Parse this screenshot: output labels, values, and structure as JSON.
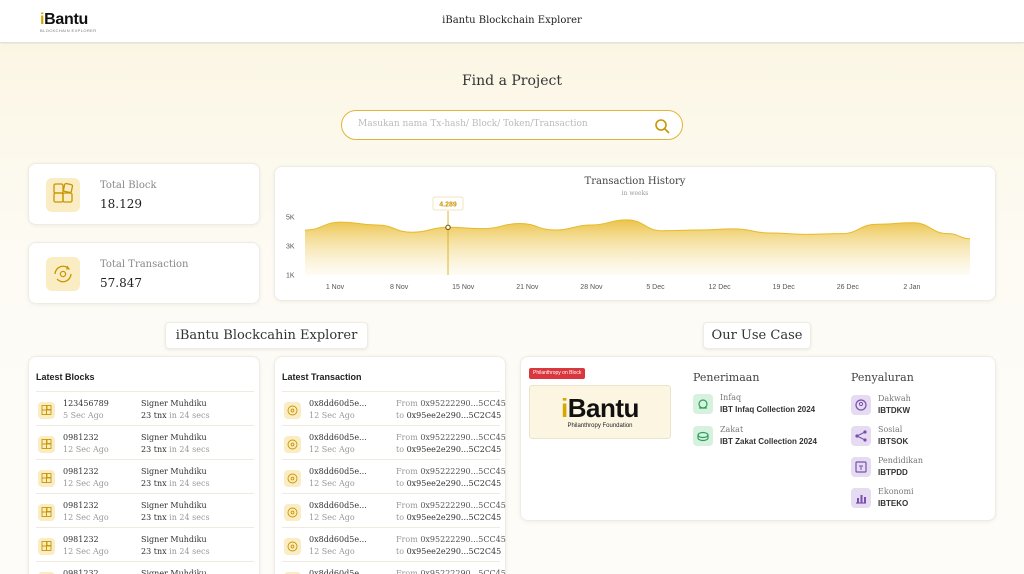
{
  "header": {
    "logo_text": "Bantu",
    "logo_i": "i",
    "logo_sub": "BLOCKCHAIN EXPLORER",
    "title": "iBantu Blockchain Explorer"
  },
  "search": {
    "title": "Find a Project",
    "placeholder": "Masukan nama Tx-hash/ Block/ Token/Transaction",
    "value": ""
  },
  "stats": {
    "block": {
      "label": "Total Block",
      "value": "18.129",
      "icon": "blocks-icon"
    },
    "transaction": {
      "label": "Total Transaction",
      "value": "57.847",
      "icon": "transaction-icon"
    }
  },
  "chart_data": {
    "type": "area",
    "title": "Transaction History",
    "subtitle": "in weeks",
    "x_ticks": [
      "1 Nov",
      "8 Nov",
      "15 Nov",
      "21 Nov",
      "28 Nov",
      "5 Dec",
      "12 Dec",
      "19 Dec",
      "26 Dec",
      "2 Jan"
    ],
    "y_ticks": [
      "1K",
      "3K",
      "5K"
    ],
    "ylim": [
      1000,
      5000
    ],
    "x": [
      0,
      0.5,
      1,
      1.5,
      2,
      2.5,
      3,
      3.5,
      4,
      4.5,
      5,
      5.5,
      6,
      6.5,
      7,
      7.5,
      8,
      8.5,
      9,
      9.3
    ],
    "values": [
      4100,
      4650,
      4450,
      3950,
      4289,
      4200,
      4550,
      4100,
      4450,
      4800,
      4050,
      4100,
      4180,
      3900,
      3800,
      3850,
      4500,
      4600,
      3850,
      3500
    ],
    "tooltip": {
      "x": 2,
      "value": "4.289"
    },
    "color": "#e8b92a",
    "grid": false
  },
  "sections": {
    "explorer_title": "iBantu Blockcahin Explorer",
    "usecase_title": "Our Use Case"
  },
  "latest_blocks": {
    "title": "Latest Blocks",
    "rows": [
      {
        "id": "123456789",
        "age": "5 Sec Ago",
        "signer": "Signer Muhdiku",
        "tnx": "23 tnx",
        "in": "in",
        "secs": "24 secs"
      },
      {
        "id": "0981232",
        "age": "12 Sec Ago",
        "signer": "Signer Muhdiku",
        "tnx": "23 tnx",
        "in": "in",
        "secs": "24 secs"
      },
      {
        "id": "0981232",
        "age": "12 Sec Ago",
        "signer": "Signer Muhdiku",
        "tnx": "23 tnx",
        "in": "in",
        "secs": "24 secs"
      },
      {
        "id": "0981232",
        "age": "12 Sec Ago",
        "signer": "Signer Muhdiku",
        "tnx": "23 tnx",
        "in": "in",
        "secs": "24 secs"
      },
      {
        "id": "0981232",
        "age": "12 Sec Ago",
        "signer": "Signer Muhdiku",
        "tnx": "23 tnx",
        "in": "in",
        "secs": "24 secs"
      },
      {
        "id": "0981232",
        "age": "",
        "signer": "Signer Muhdiku",
        "tnx": "",
        "in": "",
        "secs": ""
      }
    ]
  },
  "latest_transactions": {
    "title": "Latest Transaction",
    "rows": [
      {
        "hash": "0x8dd60d5e...",
        "age": "12 Sec Ago",
        "from_label": "From",
        "from": "0x95222290...5CC45",
        "to_label": "to",
        "to": "0x95ee2e290...5C2C45"
      },
      {
        "hash": "0x8dd60d5e...",
        "age": "12 Sec Ago",
        "from_label": "From",
        "from": "0x95222290...5CC45",
        "to_label": "to",
        "to": "0x95ee2e290...5C2C45"
      },
      {
        "hash": "0x8dd60d5e...",
        "age": "12 Sec Ago",
        "from_label": "From",
        "from": "0x95222290...5CC45",
        "to_label": "to",
        "to": "0x95ee2e290...5C2C45"
      },
      {
        "hash": "0x8dd60d5e...",
        "age": "12 Sec Ago",
        "from_label": "From",
        "from": "0x95222290...5CC45",
        "to_label": "to",
        "to": "0x95ee2e290...5C2C45"
      },
      {
        "hash": "0x8dd60d5e...",
        "age": "12 Sec Ago",
        "from_label": "From",
        "from": "0x95222290...5CC45",
        "to_label": "to",
        "to": "0x95ee2e290...5C2C45"
      },
      {
        "hash": "0x8dd60d5e...",
        "age": "",
        "from_label": "From",
        "from": "0x95222290...5CC45",
        "to_label": "",
        "to": ""
      }
    ]
  },
  "usecase": {
    "badge": "Philanthropy on Block",
    "logo_i": "i",
    "logo_text": "Bantu",
    "logo_sub": "Philanthropy Foundation",
    "penerimaan": {
      "title": "Penerimaan",
      "items": [
        {
          "label": "Infaq",
          "name": "IBT Infaq Collection 2024",
          "icon": "infaq-icon",
          "color": "#d6f2df"
        },
        {
          "label": "Zakat",
          "name": "IBT Zakat Collection 2024",
          "icon": "zakat-icon",
          "color": "#d6f2df"
        }
      ]
    },
    "penyaluran": {
      "title": "Penyaluran",
      "items": [
        {
          "label": "Dakwah",
          "name": "IBTDKW",
          "icon": "dakwah-icon",
          "color": "#e6dcf2"
        },
        {
          "label": "Sosial",
          "name": "IBTSOK",
          "icon": "share-icon",
          "color": "#e6dcf2"
        },
        {
          "label": "Pendidikan",
          "name": "IBTPDD",
          "icon": "education-icon",
          "color": "#e6dcf2"
        },
        {
          "label": "Ekonomi",
          "name": "IBTEKO",
          "icon": "economy-icon",
          "color": "#e6dcf2"
        }
      ]
    }
  }
}
